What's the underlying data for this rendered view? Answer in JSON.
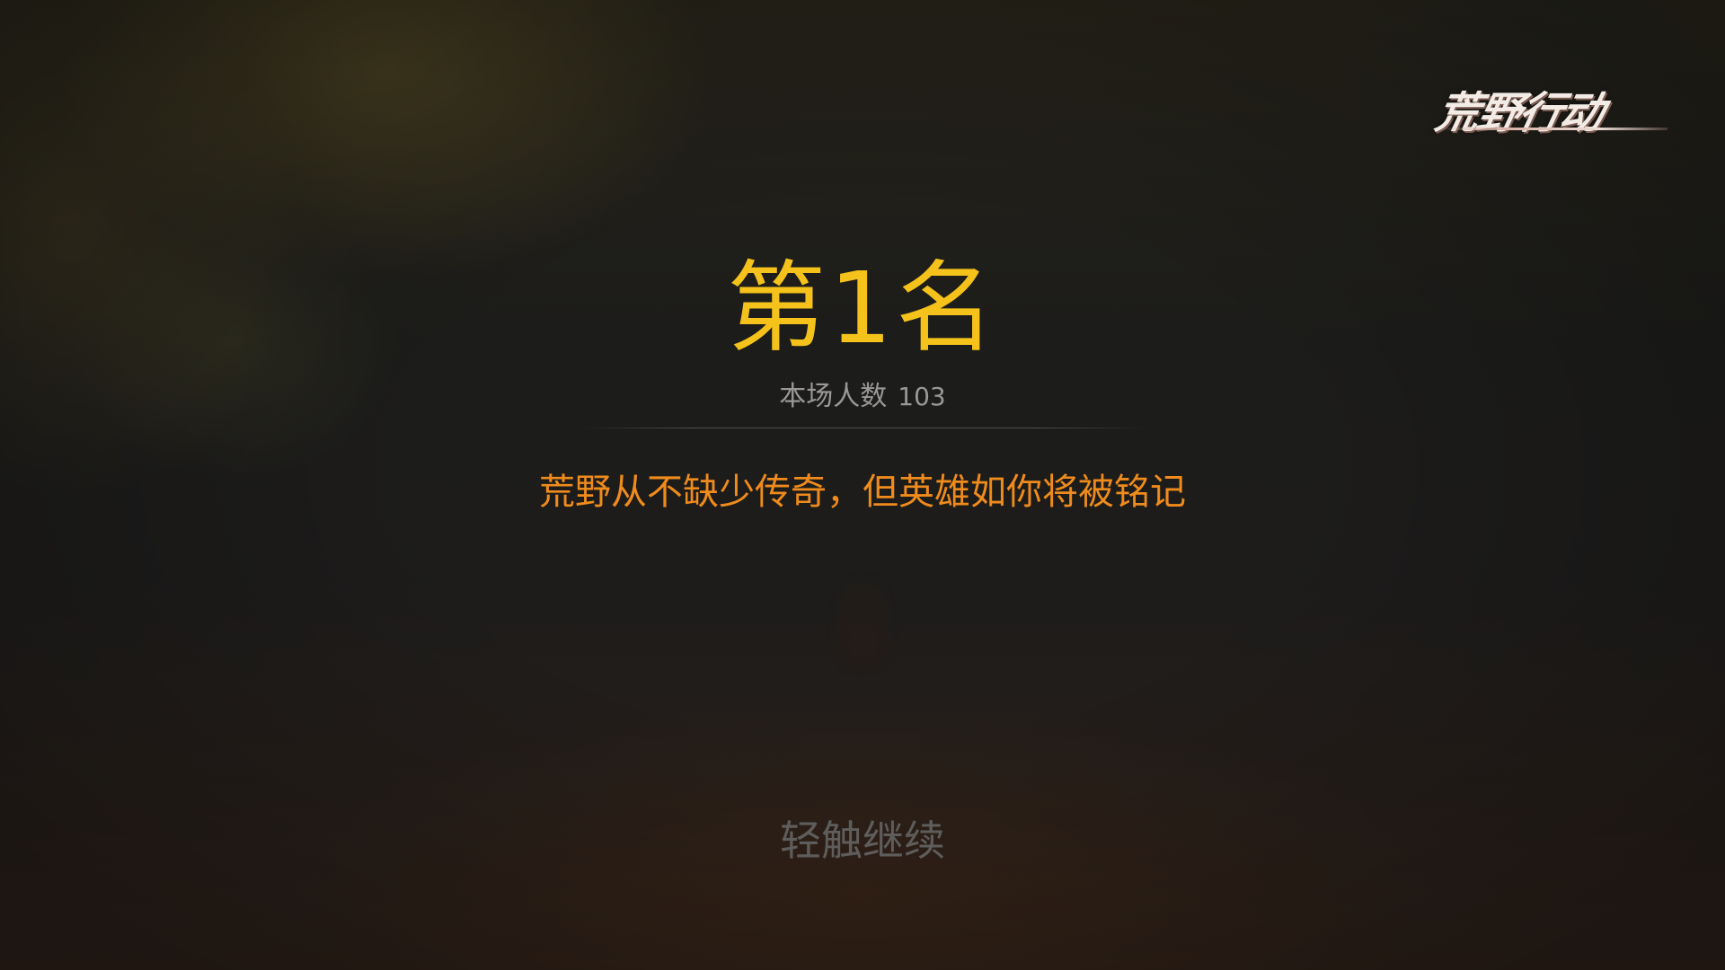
{
  "logo": {
    "text": "荒野行动"
  },
  "result": {
    "rank_label": "第1名",
    "player_count_label": "本场人数",
    "player_count_value": "103",
    "slogan": "荒野从不缺少传奇，但英雄如你将被铭记"
  },
  "actions": {
    "continue_label": "轻触继续"
  },
  "colors": {
    "rank": "#f4c21a",
    "slogan": "#ef8b1c",
    "secondary_text": "#9a9896",
    "continue_text": "#5f5d5c"
  }
}
